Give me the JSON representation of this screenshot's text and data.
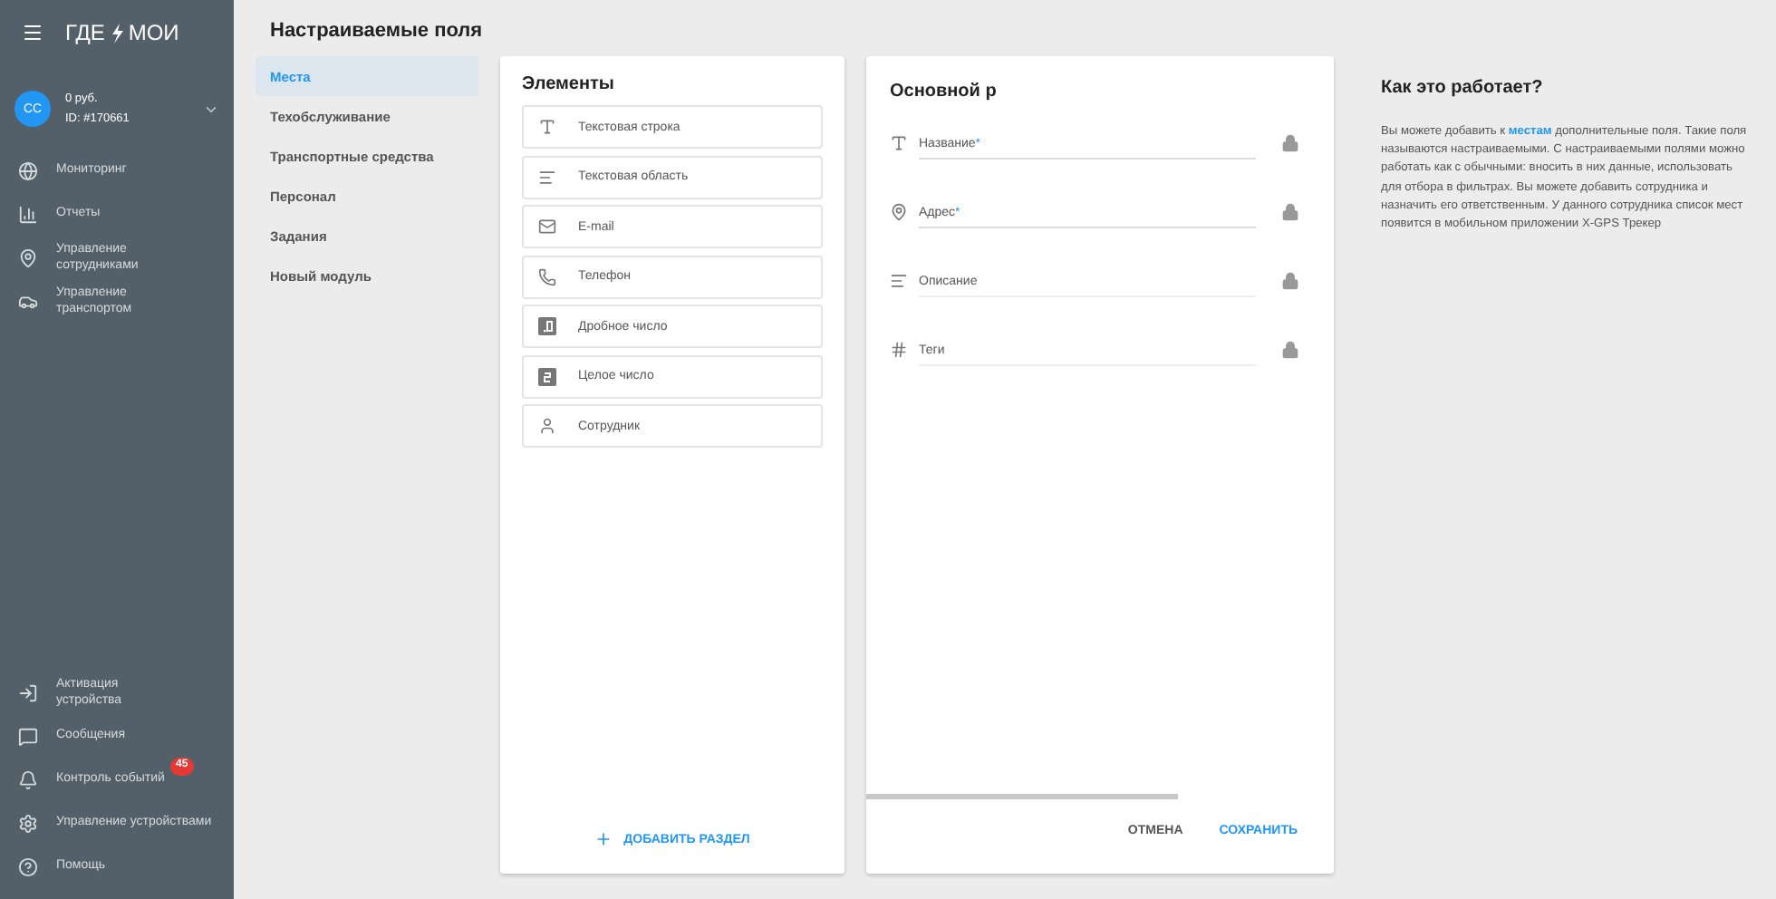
{
  "logo": {
    "left": "ГДЕ",
    "right": "МОИ"
  },
  "account": {
    "initials": "СС",
    "balance": "0 руб.",
    "id": "ID: #170661"
  },
  "nav": [
    {
      "label": "Мониторинг",
      "kind": "globe"
    },
    {
      "label": "Отчеты",
      "kind": "chart"
    },
    {
      "label": "Управление сотрудниками",
      "kind": "pin"
    },
    {
      "label": "Управление транспортом",
      "kind": "car"
    }
  ],
  "nav_bottom": [
    {
      "label": "Активация устройства",
      "kind": "login"
    },
    {
      "label": "Сообщения",
      "kind": "message"
    },
    {
      "label": "Контроль событий",
      "kind": "bell",
      "badge": "45"
    },
    {
      "label": "Управление устройствами",
      "kind": "gear"
    },
    {
      "label": "Помощь",
      "kind": "help"
    }
  ],
  "page_title": "Настраиваемые поля",
  "modules": [
    {
      "label": "Места",
      "selected": true
    },
    {
      "label": "Техобслуживание",
      "selected": false
    },
    {
      "label": "Транспортные средства",
      "selected": false
    },
    {
      "label": "Персонал",
      "selected": false
    },
    {
      "label": "Задания",
      "selected": false
    },
    {
      "label": "Новый модуль",
      "selected": false
    }
  ],
  "elements": {
    "title": "Элементы",
    "items": [
      {
        "label": "Текстовая строка",
        "kind": "text"
      },
      {
        "label": "Текстовая область",
        "kind": "lines"
      },
      {
        "label": "E-mail",
        "kind": "mail"
      },
      {
        "label": "Телефон",
        "kind": "phone"
      },
      {
        "label": "Дробное число",
        "kind": "decimal"
      },
      {
        "label": "Целое число",
        "kind": "integer"
      },
      {
        "label": "Сотрудник",
        "kind": "person"
      }
    ],
    "add_button": "ДОБАВИТЬ РАЗДЕЛ"
  },
  "form": {
    "title": "Основной р",
    "fields": [
      {
        "label": "Название",
        "kind": "text",
        "required_mark": "*"
      },
      {
        "label": "Адрес",
        "kind": "pin",
        "required_mark": "*"
      },
      {
        "label": "Описание",
        "kind": "lines"
      },
      {
        "label": "Теги",
        "kind": "hash"
      }
    ],
    "cancel": "ОТМЕНА",
    "save": "СОХРАНИТЬ"
  },
  "help": {
    "title": "Как это работает?",
    "before": "Вы можете добавить к ",
    "link": "местам",
    "after": " дополнительные поля. Такие поля называются настраиваемыми. С настраиваемыми полями можно работать как с обычными: вносить в них данные, использовать для отбора в фильтрах. Вы можете добавить сотрудника и назначить его ответственным. У данного сотрудника список мест появится в мобильном приложении X-GPS Трекер"
  }
}
